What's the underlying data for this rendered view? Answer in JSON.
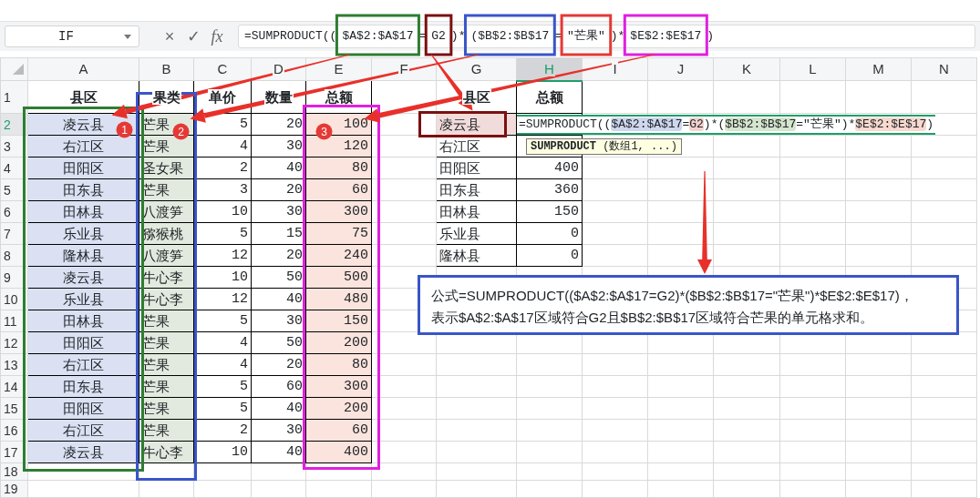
{
  "name_box": {
    "value": "IF"
  },
  "formula_bar": {
    "buttons": [
      "×",
      "✓",
      "fx"
    ],
    "segments": [
      {
        "text": "=SUMPRODUCT(("
      },
      {
        "text": "$A$2:$A$17",
        "frame": {
          "color": "#2e7d32"
        }
      },
      {
        "text": "="
      },
      {
        "text": "G2",
        "frame": {
          "color": "#7b1010"
        }
      },
      {
        "text": ")*"
      },
      {
        "text": "($B$2:$B$17",
        "frame": {
          "color": "#3a55c8"
        }
      },
      {
        "text": "="
      },
      {
        "text": "\"芒果\"",
        "frame": {
          "color": "#e53935"
        }
      },
      {
        "text": ")*"
      },
      {
        "text": "$E$2:$E$17",
        "frame": {
          "color": "#e020e0"
        }
      },
      {
        "text": ")"
      }
    ]
  },
  "columns": [
    {
      "label": "A",
      "selected": false
    },
    {
      "label": "B",
      "selected": false
    },
    {
      "label": "C",
      "selected": false
    },
    {
      "label": "D",
      "selected": false
    },
    {
      "label": "E",
      "selected": false
    },
    {
      "label": "F",
      "selected": false
    },
    {
      "label": "G",
      "selected": false
    },
    {
      "label": "H",
      "selected": true
    },
    {
      "label": "I",
      "selected": false
    },
    {
      "label": "J",
      "selected": false
    },
    {
      "label": "K",
      "selected": false
    },
    {
      "label": "L",
      "selected": false
    },
    {
      "label": "M",
      "selected": false
    },
    {
      "label": "N",
      "selected": false
    }
  ],
  "row_headers": [
    {
      "label": "1",
      "selected": false
    },
    {
      "label": "2",
      "selected": true
    },
    {
      "label": "3",
      "selected": false
    },
    {
      "label": "4",
      "selected": false
    },
    {
      "label": "5",
      "selected": false
    },
    {
      "label": "6",
      "selected": false
    },
    {
      "label": "7",
      "selected": false
    },
    {
      "label": "8",
      "selected": false
    },
    {
      "label": "9",
      "selected": false
    },
    {
      "label": "10",
      "selected": false
    },
    {
      "label": "11",
      "selected": false
    },
    {
      "label": "12",
      "selected": false
    },
    {
      "label": "13",
      "selected": false
    },
    {
      "label": "14",
      "selected": false
    },
    {
      "label": "15",
      "selected": false
    },
    {
      "label": "16",
      "selected": false
    },
    {
      "label": "17",
      "selected": false
    },
    {
      "label": "18",
      "selected": false
    },
    {
      "label": "19",
      "selected": false
    }
  ],
  "data_table": {
    "columns": [
      {
        "label": "县区",
        "highlight": {
          "color": "#dbe1f3"
        },
        "frame": {
          "color": "#2e7d32"
        },
        "badge": "1"
      },
      {
        "label": "果类",
        "highlight": {
          "color": "#e2eadf"
        },
        "frame": {
          "color": "#3a55c8"
        },
        "badge": "2"
      },
      {
        "label": "单价"
      },
      {
        "label": "数量"
      },
      {
        "label": "总额",
        "highlight": {
          "color": "#fbe4dd"
        },
        "frame": {
          "color": "#e020e0"
        },
        "badge": "3"
      }
    ],
    "rows": [
      [
        "凌云县",
        "芒果",
        "5",
        "20",
        "100"
      ],
      [
        "右江区",
        "芒果",
        "4",
        "30",
        "120"
      ],
      [
        "田阳区",
        "圣女果",
        "2",
        "40",
        "80"
      ],
      [
        "田东县",
        "芒果",
        "3",
        "20",
        "60"
      ],
      [
        "田林县",
        "八渡笋",
        "10",
        "30",
        "300"
      ],
      [
        "乐业县",
        "猕猴桃",
        "5",
        "15",
        "75"
      ],
      [
        "隆林县",
        "八渡笋",
        "12",
        "20",
        "240"
      ],
      [
        "凌云县",
        "牛心李",
        "10",
        "50",
        "500"
      ],
      [
        "乐业县",
        "牛心李",
        "12",
        "40",
        "480"
      ],
      [
        "田林县",
        "芒果",
        "5",
        "30",
        "150"
      ],
      [
        "田阳区",
        "芒果",
        "4",
        "50",
        "200"
      ],
      [
        "右江区",
        "芒果",
        "4",
        "20",
        "80"
      ],
      [
        "田东县",
        "芒果",
        "5",
        "60",
        "300"
      ],
      [
        "田阳区",
        "芒果",
        "5",
        "40",
        "200"
      ],
      [
        "右江区",
        "芒果",
        "2",
        "30",
        "60"
      ],
      [
        "凌云县",
        "牛心李",
        "10",
        "40",
        "400"
      ]
    ]
  },
  "summary_table": {
    "columns": [
      "县区",
      "总额"
    ],
    "rows": [
      {
        "region": "凌云县",
        "editing": true,
        "frame": {
          "color": "#7b1010"
        },
        "editor_segments": [
          {
            "text": "=SUMPRODUCT(("
          },
          {
            "text": "$A$2:$A$17",
            "color": "#cfd7ef"
          },
          {
            "text": "="
          },
          {
            "text": "G2",
            "color": "#f3d3cf"
          },
          {
            "text": ")*("
          },
          {
            "text": "$B$2:$B$17",
            "color": "#d6e5cd"
          },
          {
            "text": "=\"芒果\")*"
          },
          {
            "text": "$E$2:$E$17",
            "color": "#f7d9cf"
          },
          {
            "text": ")"
          }
        ]
      },
      {
        "region": "右江区",
        "editing": false
      },
      {
        "region": "田阳区",
        "editing": false,
        "total": "400"
      },
      {
        "region": "田东县",
        "editing": false,
        "total": "360"
      },
      {
        "region": "田林县",
        "editing": false,
        "total": "150"
      },
      {
        "region": "乐业县",
        "editing": false,
        "total": "0"
      },
      {
        "region": "隆林县",
        "editing": false,
        "total": "0"
      }
    ],
    "tooltip": "**SUMPRODUCT** (数组1, ...)"
  },
  "note": {
    "lines": [
      "公式=SUMPRODUCT(($A$2:$A$17=G2)*($B$2:$B$17=\"芒果\")*$E$2:$E$17)，",
      "表示$A$2:$A$17区域符合G2且$B$2:$B$17区域符合芒果的单元格求和。"
    ]
  }
}
